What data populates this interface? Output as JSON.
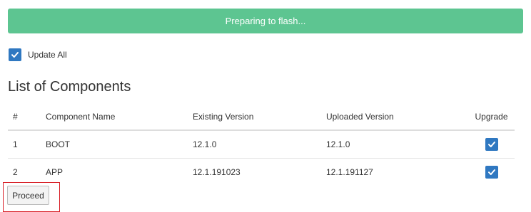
{
  "banner": {
    "text": "Preparing to flash...",
    "color": "#5dc591"
  },
  "update_all": {
    "label": "Update All",
    "checked": true
  },
  "section_title": "List of Components",
  "table": {
    "headers": [
      "#",
      "Component Name",
      "Existing Version",
      "Uploaded Version",
      "Upgrade"
    ],
    "rows": [
      {
        "num": "1",
        "name": "BOOT",
        "existing": "12.1.0",
        "uploaded": "12.1.0",
        "upgrade": true
      },
      {
        "num": "2",
        "name": "APP",
        "existing": "12.1.191023",
        "uploaded": "12.1.191127",
        "upgrade": true
      }
    ]
  },
  "proceed_label": "Proceed",
  "colors": {
    "accent": "#2f78c1",
    "highlight": "#d81f26"
  }
}
